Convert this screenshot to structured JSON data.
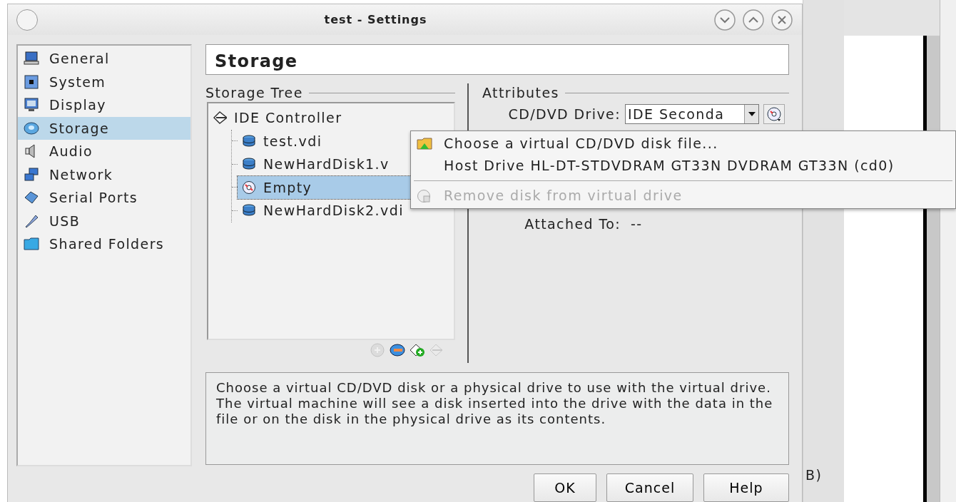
{
  "window": {
    "title": "test - Settings"
  },
  "sidebar": {
    "items": [
      {
        "label": "General",
        "kind": "general",
        "selected": false
      },
      {
        "label": "System",
        "kind": "system",
        "selected": false
      },
      {
        "label": "Display",
        "kind": "display",
        "selected": false
      },
      {
        "label": "Storage",
        "kind": "storage",
        "selected": true
      },
      {
        "label": "Audio",
        "kind": "audio",
        "selected": false
      },
      {
        "label": "Network",
        "kind": "network",
        "selected": false
      },
      {
        "label": "Serial Ports",
        "kind": "serial",
        "selected": false
      },
      {
        "label": "USB",
        "kind": "usb",
        "selected": false
      },
      {
        "label": "Shared Folders",
        "kind": "folder",
        "selected": false
      }
    ]
  },
  "page_title": "Storage",
  "storage_tree": {
    "title": "Storage Tree",
    "items": [
      {
        "label": "IDE Controller",
        "kind": "controller",
        "selected": false,
        "children": [
          {
            "label": "test.vdi",
            "kind": "hdd",
            "selected": false
          },
          {
            "label": "NewHardDisk1.v",
            "kind": "hdd",
            "selected": false
          },
          {
            "label": "Empty",
            "kind": "cd",
            "selected": true
          },
          {
            "label": "NewHardDisk2.vdi",
            "kind": "hdd",
            "selected": false
          }
        ]
      }
    ],
    "toolbar": [
      {
        "kind": "add-controller",
        "disabled": true
      },
      {
        "kind": "remove-controller",
        "disabled": false
      },
      {
        "kind": "add-attachment",
        "disabled": false
      },
      {
        "kind": "remove-attachment",
        "disabled": true
      }
    ]
  },
  "attributes": {
    "title": "Attributes",
    "cd_dvd_drive": {
      "label": "CD/DVD Drive:",
      "value": "IDE Seconda"
    },
    "attached_to": {
      "label": "Attached To:",
      "value": "--"
    }
  },
  "menu": {
    "items": [
      {
        "kind": "file",
        "label": "Choose a virtual CD/DVD disk file...",
        "disabled": false
      },
      {
        "kind": "host",
        "label": "Host Drive HL-DT-STDVDRAM GT33N DVDRAM GT33N (cd0)",
        "disabled": false
      },
      {
        "kind": "separator"
      },
      {
        "kind": "remove",
        "label": "Remove disk from virtual drive",
        "disabled": true
      }
    ]
  },
  "description": "Choose a virtual CD/DVD disk or a physical drive to use with the virtual drive. The virtual machine will see a disk inserted into the drive with the data in the file or on the disk in the physical drive as its contents.",
  "buttons": [
    {
      "label": "OK"
    },
    {
      "label": "Cancel"
    },
    {
      "label": "Help"
    }
  ],
  "background_window": {
    "text": "B)"
  }
}
